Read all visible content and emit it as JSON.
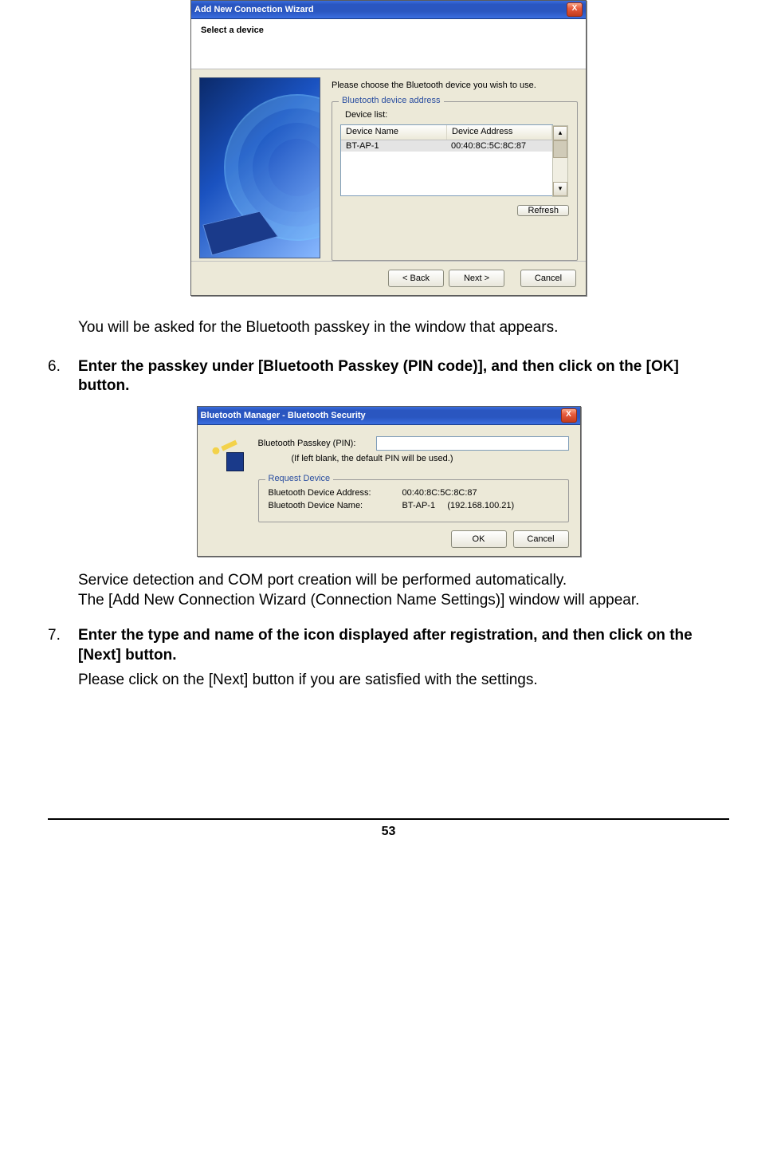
{
  "wizard": {
    "title": "Add New Connection Wizard",
    "subtitle": "Select a device",
    "instruction": "Please choose the Bluetooth device you wish to use.",
    "fieldset_label": "Bluetooth device address",
    "listbox_label": "Device list:",
    "columns": {
      "name": "Device Name",
      "address": "Device Address"
    },
    "rows": [
      {
        "name": "BT-AP-1",
        "address": "00:40:8C:5C:8C:87"
      }
    ],
    "scroll_up": "▴",
    "scroll_down": "▾",
    "refresh": "Refresh",
    "back": "< Back",
    "next": "Next >",
    "cancel": "Cancel",
    "close": "X"
  },
  "doc": {
    "para1": "You will be asked for the Bluetooth passkey in the window that appears.",
    "step6_num": "6.",
    "step6": "Enter the passkey under [Bluetooth Passkey (PIN code)], and then click on the [OK] button.",
    "para2a": "Service detection and COM port creation will be performed automatically.",
    "para2b": "The [Add New Connection Wizard (Connection Name Settings)] window will appear.",
    "step7_num": "7.",
    "step7": "Enter the type and name of the icon displayed after registration, and then click on the [Next] button.",
    "step7_follow": "Please click on the [Next] button if you are satisfied with the settings.",
    "page_number": "53"
  },
  "security": {
    "title": "Bluetooth Manager - Bluetooth Security",
    "pin_label": "Bluetooth Passkey (PIN):",
    "pin_value": "",
    "hint": "(If left blank, the default PIN will be used.)",
    "request_legend": "Request Device",
    "addr_label": "Bluetooth Device Address:",
    "addr_value": "00:40:8C:5C:8C:87",
    "name_label": "Bluetooth Device Name:",
    "name_value": "BT-AP-1     (192.168.100.21)",
    "ok": "OK",
    "cancel": "Cancel",
    "close": "X"
  }
}
